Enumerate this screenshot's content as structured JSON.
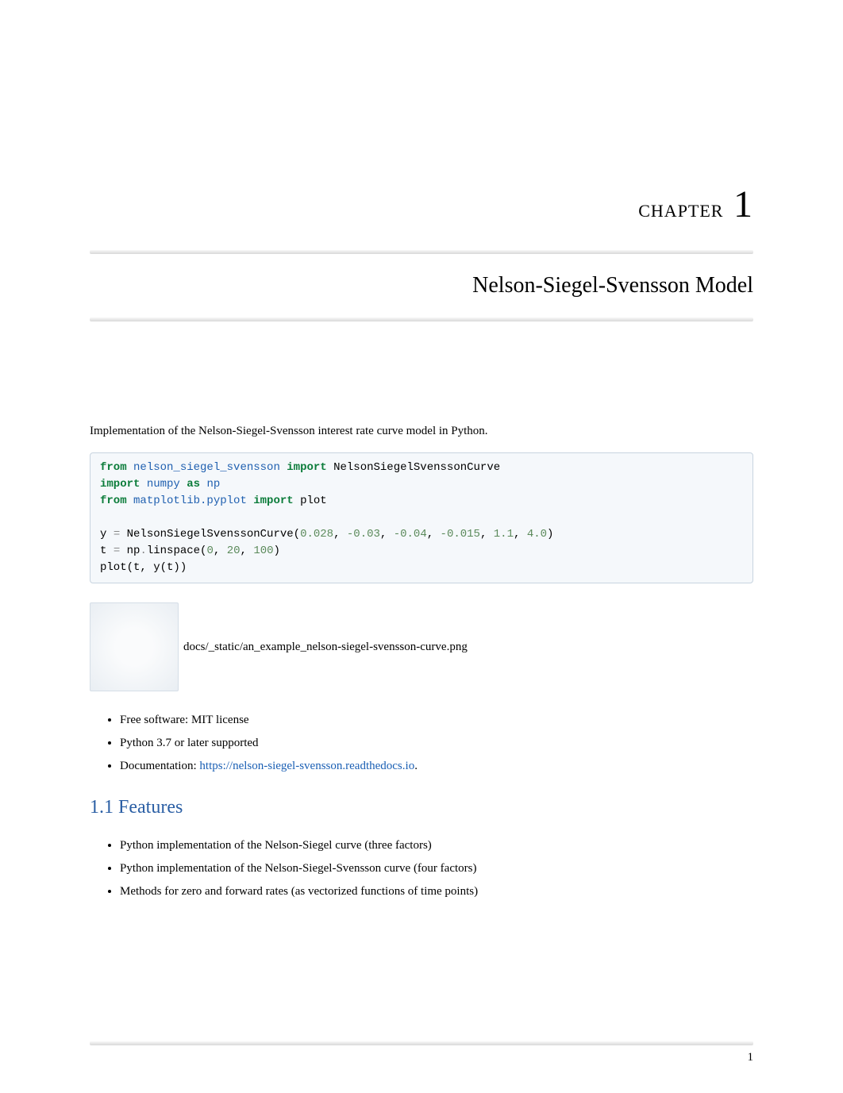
{
  "chapter": {
    "label": "CHAPTER",
    "number": "1"
  },
  "title": "Nelson-Siegel-Svensson Model",
  "intro": "Implementation of the Nelson-Siegel-Svensson interest rate curve model in Python.",
  "code": {
    "from1": "from",
    "mod1": "nelson_siegel_svensson",
    "import1": "import",
    "sym1": "NelsonSiegelSvenssonCurve",
    "import2": "import",
    "mod2": "numpy",
    "as2": "as",
    "alias2": "np",
    "from3": "from",
    "mod3": "matplotlib.pyplot",
    "import3": "import",
    "sym3": "plot",
    "line4a": "y ",
    "eq4": "=",
    "call4": " NelsonSiegelSvenssonCurve(",
    "n1": "0.028",
    "n2": "0.03",
    "n3": "0.04",
    "n4": "0.015",
    "n5": "1.1",
    "n6": "4.0",
    "line5a": "t ",
    "eq5": "=",
    "call5": " np",
    "dot5": ".",
    "call5b": "linspace(",
    "ls1": "0",
    "ls2": "20",
    "ls3": "100",
    "line6": "plot(t, y(t))"
  },
  "img_path": "docs/_static/an_example_nelson-siegel-svensson-curve.png",
  "list1": [
    "Free software: MIT license",
    "Python 3.7 or later supported",
    "Documentation: "
  ],
  "docs_link": "https://nelson-siegel-svensson.readthedocs.io",
  "section_heading": "1.1  Features",
  "list2": [
    "Python implementation of the Nelson-Siegel curve (three factors)",
    "Python implementation of the Nelson-Siegel-Svensson curve (four factors)",
    "Methods for zero and forward rates (as vectorized functions of time points)"
  ],
  "page_number": "1",
  "chart_data": {
    "type": "line",
    "note": "Chart image is a placeholder/broken link in the source screenshot; no plotted data visible.",
    "title": "",
    "series": []
  }
}
